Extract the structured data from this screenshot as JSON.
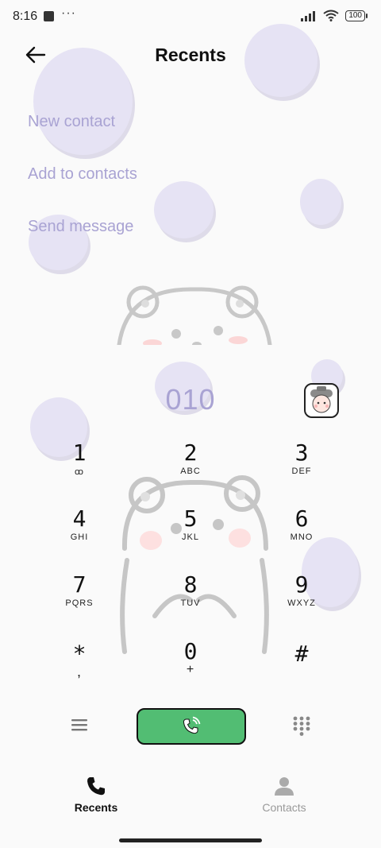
{
  "status": {
    "time": "8:16",
    "dots": "···",
    "battery": "100"
  },
  "header": {
    "title": "Recents",
    "back_icon": "arrow-left-icon"
  },
  "menu": [
    {
      "label": "New contact"
    },
    {
      "label": "Add to contacts"
    },
    {
      "label": "Send message"
    }
  ],
  "dialer": {
    "number": "010",
    "keys": [
      {
        "digit": "1",
        "letters": "ꝏ"
      },
      {
        "digit": "2",
        "letters": "ABC"
      },
      {
        "digit": "3",
        "letters": "DEF"
      },
      {
        "digit": "4",
        "letters": "GHI"
      },
      {
        "digit": "5",
        "letters": "JKL"
      },
      {
        "digit": "6",
        "letters": "MNO"
      },
      {
        "digit": "7",
        "letters": "PQRS"
      },
      {
        "digit": "8",
        "letters": "TUV"
      },
      {
        "digit": "9",
        "letters": "WXYZ"
      },
      {
        "digit": "*",
        "letters": ","
      },
      {
        "digit": "0",
        "letters": "+"
      },
      {
        "digit": "#",
        "letters": ""
      }
    ]
  },
  "bottom_nav": {
    "recents": "Recents",
    "contacts": "Contacts"
  },
  "colors": {
    "accent": "#a9a3d3",
    "call": "#52bd73",
    "blob": "#e6e3f4"
  }
}
